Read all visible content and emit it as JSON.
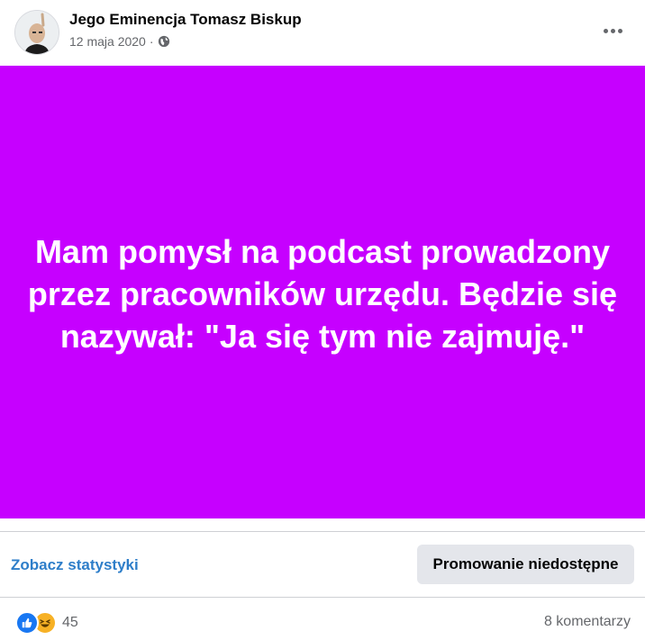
{
  "post": {
    "author": "Jego Eminencja Tomasz Biskup",
    "date": "12 maja 2020",
    "separator": "·",
    "visibility_icon": "globe-icon",
    "menu_icon": "more-horizontal-icon",
    "background_color": "#c600ff",
    "text": "Mam pomysł na podcast prowadzony przez pracowników urzędu. Będzie się nazywał: \"Ja się tym nie zajmuję.\""
  },
  "actions": {
    "stats_link": "Zobacz statystyki",
    "promo_button": "Promowanie niedostępne"
  },
  "footer": {
    "reaction_icons": [
      "like-icon",
      "haha-icon"
    ],
    "reaction_count": "45",
    "comments": "8 komentarzy"
  },
  "colors": {
    "link": "#2e7ec9",
    "like": "#1877f2",
    "haha": "#f7b125",
    "secondary_text": "#65676b"
  }
}
